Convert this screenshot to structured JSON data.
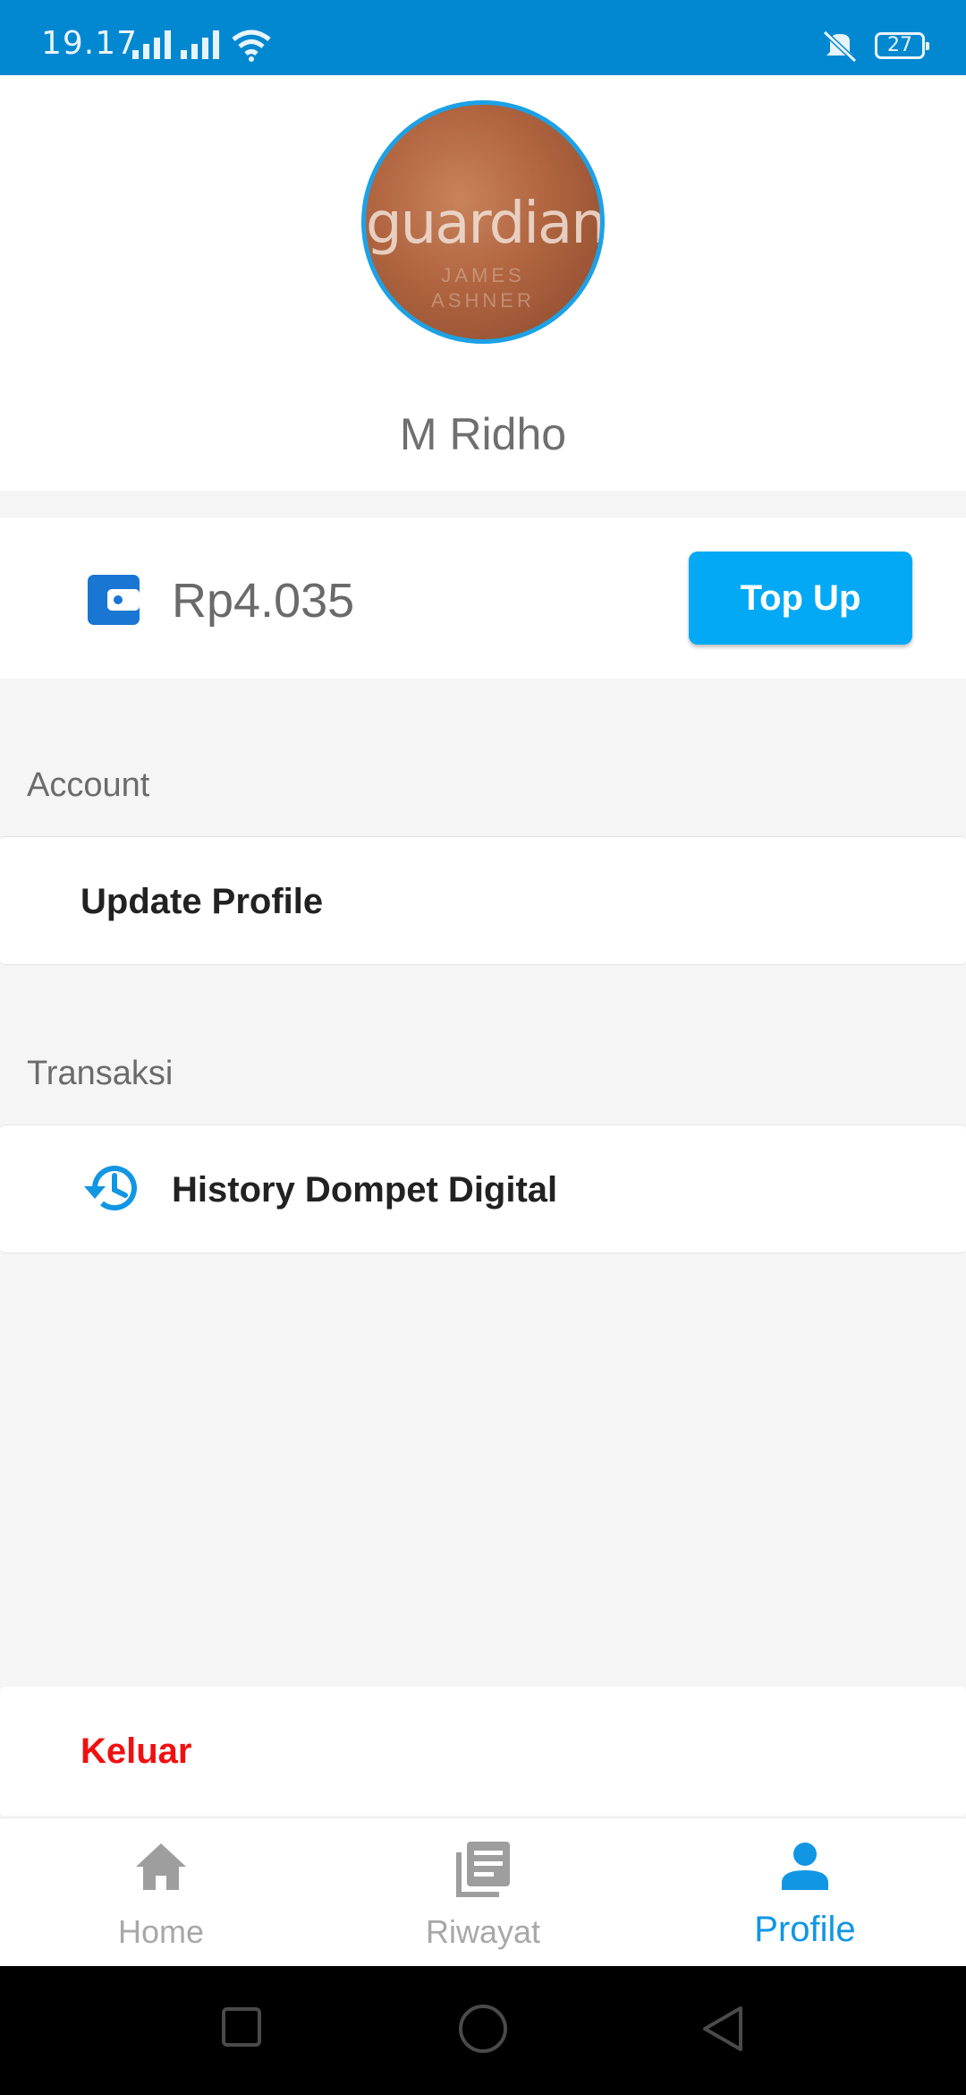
{
  "status_bar": {
    "time": "19.17",
    "battery": "27"
  },
  "profile": {
    "name": "M Ridho",
    "avatar_text": "guardian",
    "avatar_sub1": "JAMES",
    "avatar_sub2": "ASHNER"
  },
  "wallet": {
    "balance": "Rp4.035",
    "topup_label": "Top Up",
    "icon": "wallet-icon"
  },
  "sections": {
    "account_title": "Account",
    "update_profile": "Update Profile",
    "transaksi_title": "Transaksi",
    "history": "History Dompet Digital"
  },
  "logout_label": "Keluar",
  "bottom_nav": {
    "items": [
      {
        "label": "Home",
        "icon": "home-icon",
        "active": false
      },
      {
        "label": "Riwayat",
        "icon": "list-icon",
        "active": false
      },
      {
        "label": "Profile",
        "icon": "person-icon",
        "active": true
      }
    ]
  },
  "colors": {
    "primary": "#03a9f4",
    "status_bar": "#0288d1",
    "logout": "#f01010",
    "active_nav": "#1196e4"
  }
}
